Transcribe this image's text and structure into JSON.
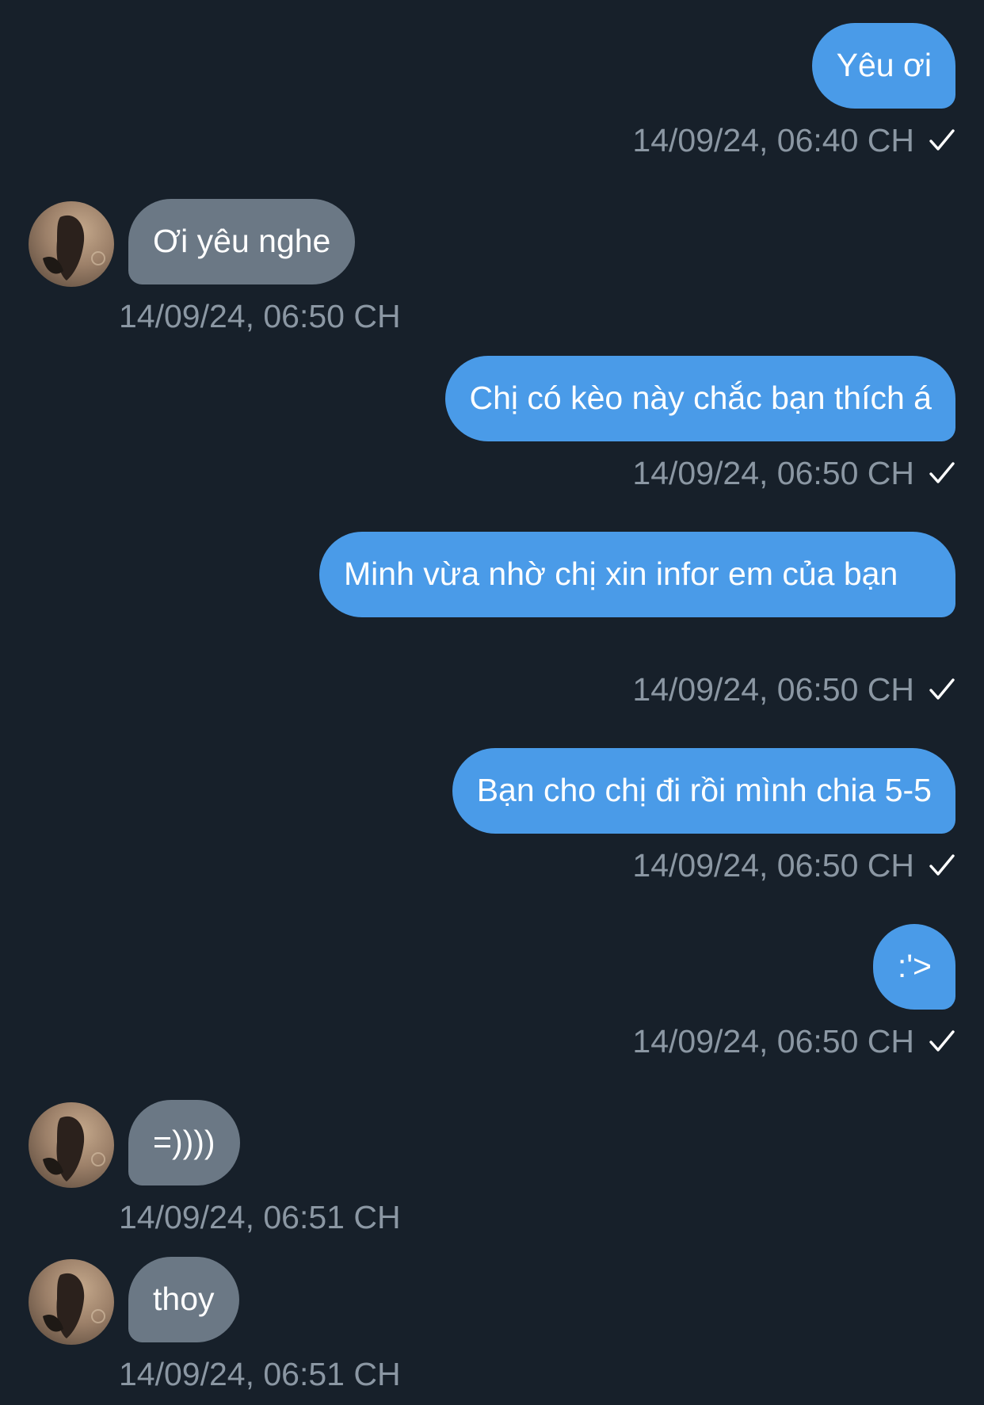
{
  "conversation": {
    "messages": [
      {
        "direction": "out",
        "text": "Yêu ơi",
        "timestamp": "14/09/24, 06:40 CH",
        "status": "check-icon"
      },
      {
        "direction": "in",
        "text": "Ơi yêu nghe",
        "timestamp": "14/09/24, 06:50 CH"
      },
      {
        "direction": "out",
        "text": "Chị có kèo này chắc bạn thích á",
        "timestamp": "14/09/24, 06:50 CH",
        "status": "check-icon"
      },
      {
        "direction": "out",
        "text": "Minh vừa nhờ chị xin infor em của bạn",
        "timestamp": "14/09/24, 06:50 CH",
        "status": "check-icon"
      },
      {
        "direction": "out",
        "text": "Bạn cho chị đi rồi mình chia 5-5",
        "timestamp": "14/09/24, 06:50 CH",
        "status": "check-icon"
      },
      {
        "direction": "out",
        "text": ":'>",
        "timestamp": "14/09/24, 06:50 CH",
        "status": "check-icon"
      },
      {
        "direction": "in",
        "text": "=))))",
        "timestamp": "14/09/24, 06:51 CH"
      },
      {
        "direction": "in",
        "text": "thoy",
        "timestamp": "14/09/24, 06:51 CH"
      }
    ]
  },
  "colors": {
    "background": "#17202a",
    "outgoing_bubble": "#4a9be8",
    "incoming_bubble": "#6b7885",
    "timestamp_text": "#8b97a3"
  }
}
